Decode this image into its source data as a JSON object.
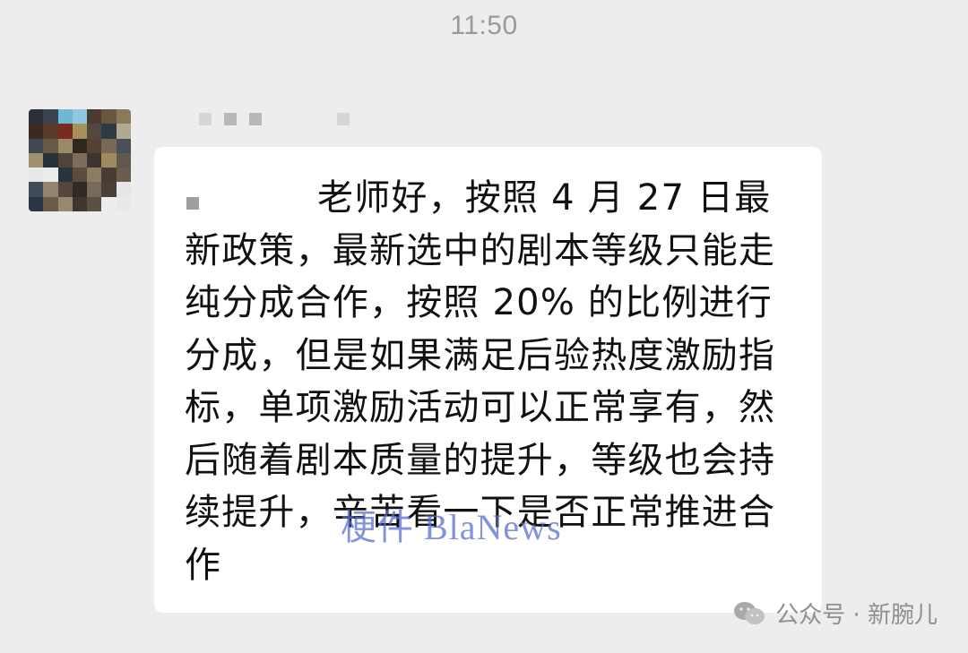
{
  "chat": {
    "timestamp": "11:50",
    "message": "老师好，按照 4 月 27 日最新政策，最新选中的剧本等级只能走纯分成合作，按照 20% 的比例进行分成，但是如果满足后验热度激励指标，单项激励活动可以正常享有，然后随着剧本质量的提升，等级也会持续提升，辛苦看一下是否正常推进合作"
  },
  "watermarks": {
    "overlay_text": "梗件 BlaNews",
    "footer_text": "公众号 · 新腕儿",
    "footer_icon": "wechat-icon"
  },
  "colors": {
    "background": "#ededed",
    "bubble": "#ffffff",
    "text": "#111111",
    "timestamp": "#9a9a9a",
    "watermark": "#5a6ed2"
  }
}
